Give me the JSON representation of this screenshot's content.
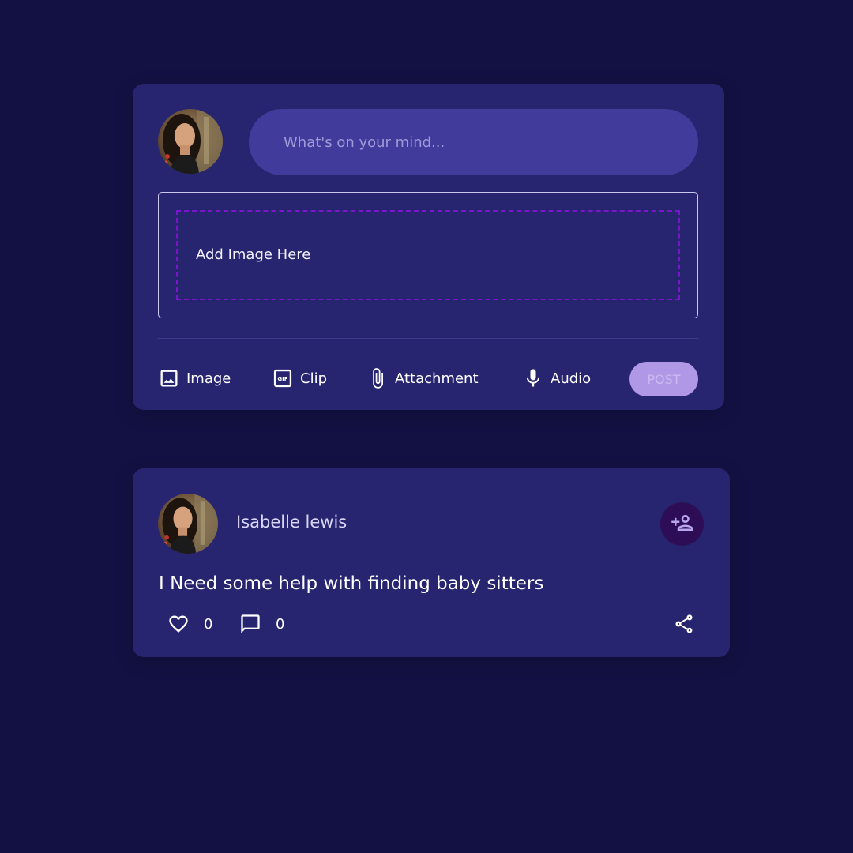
{
  "composer": {
    "input_placeholder": "What's on your mind...",
    "dropzone_label": "Add Image Here",
    "tools": {
      "image": {
        "label": "Image",
        "icon": "image-icon"
      },
      "clip": {
        "label": "Clip",
        "icon": "gif-icon"
      },
      "attachment": {
        "label": "Attachment",
        "icon": "paperclip-icon"
      },
      "audio": {
        "label": "Audio",
        "icon": "microphone-icon"
      }
    },
    "post_label": "POST"
  },
  "post": {
    "author": "Isabelle lewis",
    "text": "I Need some help with finding baby sitters",
    "likes": "0",
    "comments": "0",
    "icons": {
      "follow": "add-person-icon",
      "like": "heart-outline-icon",
      "comment": "comment-icon",
      "share": "share-icon"
    }
  },
  "colors": {
    "background": "#131143",
    "card": "#272470",
    "input": "#413c9b",
    "dashed_border": "#7a16c9",
    "post_button": "#b198e6",
    "follow_button": "#2e0d57"
  }
}
